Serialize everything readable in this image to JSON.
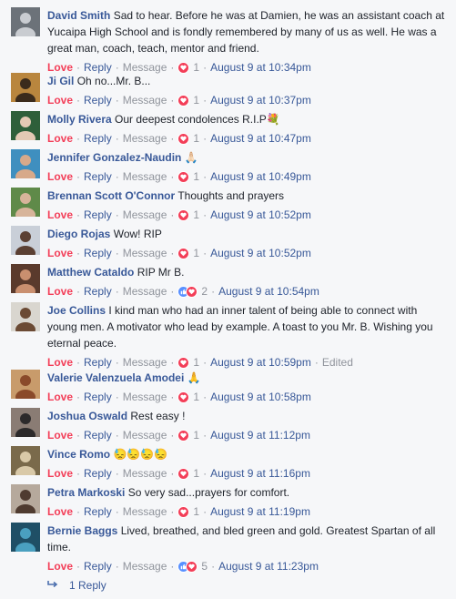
{
  "comments": [
    {
      "name": "David Smith",
      "text": "Sad to hear. Before he was at Damien, he was an assistant coach at Yucaipa High School and is fondly remembered by many of us as well. He was a great man, coach, teach, mentor and friend.",
      "emoji": "",
      "love": "Love",
      "reply": "Reply",
      "message": "Message",
      "reactions": "heart",
      "count": "1",
      "time": "August 9 at 10:34pm",
      "edited": "",
      "avatar_bg": "#6c7279",
      "avatar_fg": "#c9ccd1"
    },
    {
      "name": "Ji Gil",
      "text": "Oh no...Mr. B...",
      "emoji": "",
      "love": "Love",
      "reply": "Reply",
      "message": "Message",
      "reactions": "heart",
      "count": "1",
      "time": "August 9 at 10:37pm",
      "edited": "",
      "avatar_bg": "#b9863e",
      "avatar_fg": "#3b2b1c"
    },
    {
      "name": "Molly Rivera",
      "text": "Our deepest condolences R.I.P",
      "emoji": "💐",
      "love": "Love",
      "reply": "Reply",
      "message": "Message",
      "reactions": "heart",
      "count": "1",
      "time": "August 9 at 10:47pm",
      "edited": "",
      "avatar_bg": "#2e5f3a",
      "avatar_fg": "#e3c9b4"
    },
    {
      "name": "Jennifer Gonzalez-Naudin",
      "text": "",
      "emoji": "🙏🏻",
      "love": "Love",
      "reply": "Reply",
      "message": "Message",
      "reactions": "heart",
      "count": "1",
      "time": "August 9 at 10:49pm",
      "edited": "",
      "avatar_bg": "#3f8fbf",
      "avatar_fg": "#d7a98a"
    },
    {
      "name": "Brennan Scott O'Connor",
      "text": "Thoughts and prayers",
      "emoji": "",
      "love": "Love",
      "reply": "Reply",
      "message": "Message",
      "reactions": "heart",
      "count": "1",
      "time": "August 9 at 10:52pm",
      "edited": "",
      "avatar_bg": "#5f8a49",
      "avatar_fg": "#d7b49a"
    },
    {
      "name": "Diego Rojas",
      "text": "Wow! RIP",
      "emoji": "",
      "love": "Love",
      "reply": "Reply",
      "message": "Message",
      "reactions": "heart",
      "count": "1",
      "time": "August 9 at 10:52pm",
      "edited": "",
      "avatar_bg": "#c9cfd8",
      "avatar_fg": "#5b4033"
    },
    {
      "name": "Matthew Cataldo",
      "text": "RIP Mr B.",
      "emoji": "",
      "love": "Love",
      "reply": "Reply",
      "message": "Message",
      "reactions": "like-heart",
      "count": "2",
      "time": "August 9 at 10:54pm",
      "edited": "",
      "avatar_bg": "#5a3a2c",
      "avatar_fg": "#c98f6f"
    },
    {
      "name": "Joe Collins",
      "text": "I kind man who had an inner talent of being able to connect with young men. A motivator who lead by example. A toast to you Mr. B. Wishing you eternal peace.",
      "emoji": "",
      "love": "Love",
      "reply": "Reply",
      "message": "Message",
      "reactions": "heart",
      "count": "1",
      "time": "August 9 at 10:59pm",
      "edited": "Edited",
      "avatar_bg": "#d9d6cf",
      "avatar_fg": "#6b4a34"
    },
    {
      "name": "Valerie Valenzuela Amodei",
      "text": "",
      "emoji": "🙏",
      "love": "Love",
      "reply": "Reply",
      "message": "Message",
      "reactions": "heart",
      "count": "1",
      "time": "August 9 at 10:58pm",
      "edited": "",
      "avatar_bg": "#c89b6b",
      "avatar_fg": "#8a4a2a"
    },
    {
      "name": "Joshua Oswald",
      "text": "Rest easy !",
      "emoji": "",
      "love": "Love",
      "reply": "Reply",
      "message": "Message",
      "reactions": "heart",
      "count": "1",
      "time": "August 9 at 11:12pm",
      "edited": "",
      "avatar_bg": "#8a7c74",
      "avatar_fg": "#2c2a2b"
    },
    {
      "name": "Vince Romo",
      "text": "",
      "emoji": "😓😓😓😓",
      "love": "Love",
      "reply": "Reply",
      "message": "Message",
      "reactions": "heart",
      "count": "1",
      "time": "August 9 at 11:16pm",
      "edited": "",
      "avatar_bg": "#7a6a4b",
      "avatar_fg": "#d9c9a8"
    },
    {
      "name": "Petra Markoski",
      "text": "So very sad...prayers for comfort.",
      "emoji": "",
      "love": "Love",
      "reply": "Reply",
      "message": "Message",
      "reactions": "heart",
      "count": "1",
      "time": "August 9 at 11:19pm",
      "edited": "",
      "avatar_bg": "#b6a99c",
      "avatar_fg": "#4f3b30"
    },
    {
      "name": "Bernie Baggs",
      "text": "Lived, breathed, and bled green and gold. Greatest Spartan of all time.",
      "emoji": "",
      "love": "Love",
      "reply": "Reply",
      "message": "Message",
      "reactions": "like-heart",
      "count": "5",
      "time": "August 9 at 11:23pm",
      "edited": "",
      "avatar_bg": "#1f4f66",
      "avatar_fg": "#4aa0c0"
    }
  ],
  "replies_link": "1 Reply"
}
